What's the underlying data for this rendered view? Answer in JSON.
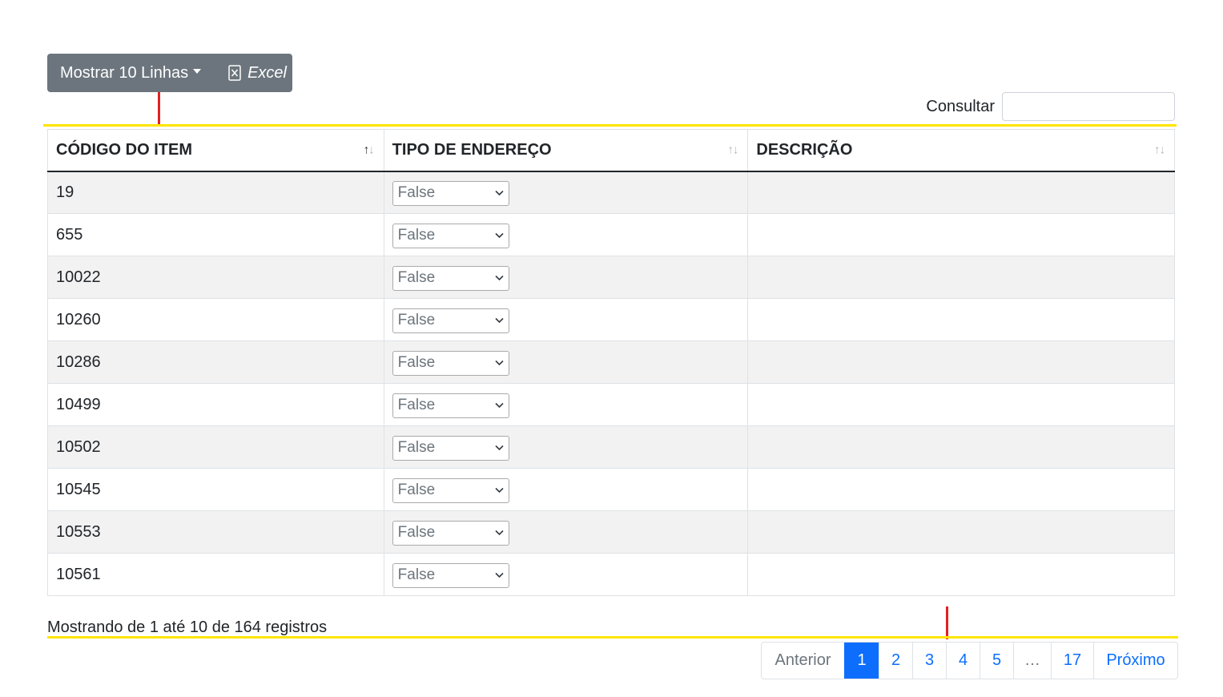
{
  "toolbar": {
    "rows_button_label": "Mostrar 10 Linhas",
    "excel_button_label": "Excel"
  },
  "search": {
    "label": "Consultar",
    "value": "",
    "placeholder": ""
  },
  "table": {
    "columns": [
      {
        "label": "CÓDIGO DO ITEM",
        "sort": "ascending"
      },
      {
        "label": "TIPO DE ENDEREÇO",
        "sort": "none"
      },
      {
        "label": "DESCRIÇÃO",
        "sort": "none"
      }
    ],
    "rows": [
      {
        "code": "19",
        "type": "False",
        "description": ""
      },
      {
        "code": "655",
        "type": "False",
        "description": ""
      },
      {
        "code": "10022",
        "type": "False",
        "description": ""
      },
      {
        "code": "10260",
        "type": "False",
        "description": ""
      },
      {
        "code": "10286",
        "type": "False",
        "description": ""
      },
      {
        "code": "10499",
        "type": "False",
        "description": ""
      },
      {
        "code": "10502",
        "type": "False",
        "description": ""
      },
      {
        "code": "10545",
        "type": "False",
        "description": ""
      },
      {
        "code": "10553",
        "type": "False",
        "description": ""
      },
      {
        "code": "10561",
        "type": "False",
        "description": ""
      }
    ]
  },
  "info_text": "Mostrando de 1 até 10 de 164 registros",
  "pagination": {
    "previous": "Anterior",
    "pages": [
      "1",
      "2",
      "3",
      "4",
      "5"
    ],
    "ellipsis": "…",
    "last_page": "17",
    "next": "Próximo",
    "active_page": "1"
  },
  "colors": {
    "toolbar_bg": "#6c757d",
    "accent": "#0d6efd",
    "annotation_red": "#e32020",
    "annotation_yellow": "#ffe500",
    "stripe": "#f2f2f2"
  }
}
